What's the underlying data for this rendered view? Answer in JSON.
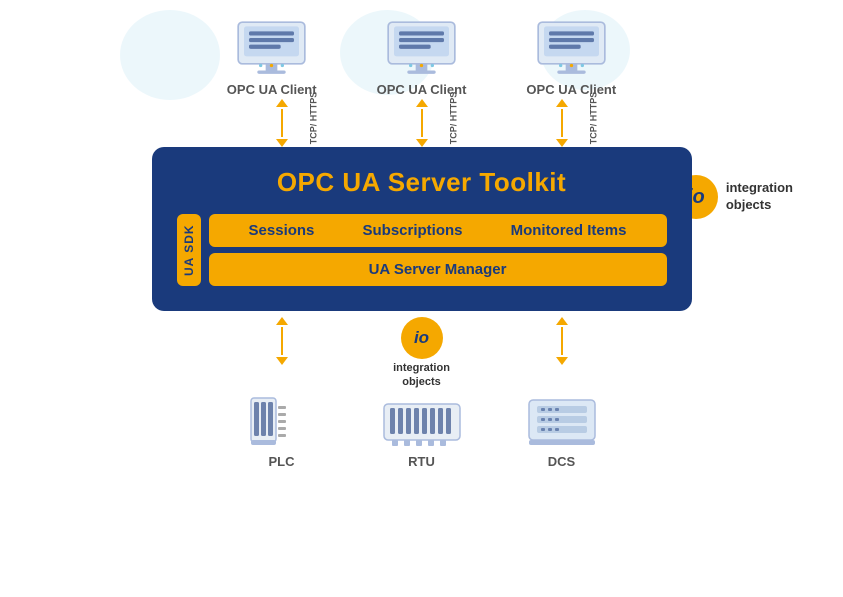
{
  "clients": [
    {
      "label": "OPC UA Client"
    },
    {
      "label": "OPC UA Client"
    },
    {
      "label": "OPC UA Client"
    }
  ],
  "arrow_label": "TCP/ HTTPS",
  "server": {
    "title": "OPC UA Server Toolkit",
    "sdk_label": "UA SDK",
    "sessions_label": "Sessions",
    "subscriptions_label": "Subscriptions",
    "monitored_items_label": "Monitored Items",
    "manager_label": "UA Server Manager"
  },
  "io_logo": {
    "badge_text": "io",
    "text_line1": "integration",
    "text_line2": "objects"
  },
  "devices": [
    {
      "label": "PLC"
    },
    {
      "label": "RTU"
    },
    {
      "label": "DCS"
    }
  ],
  "colors": {
    "navy": "#1a3a7c",
    "amber": "#f5a800",
    "text_gray": "#555555",
    "white": "#ffffff",
    "light_blue": "#7ec8e3"
  }
}
